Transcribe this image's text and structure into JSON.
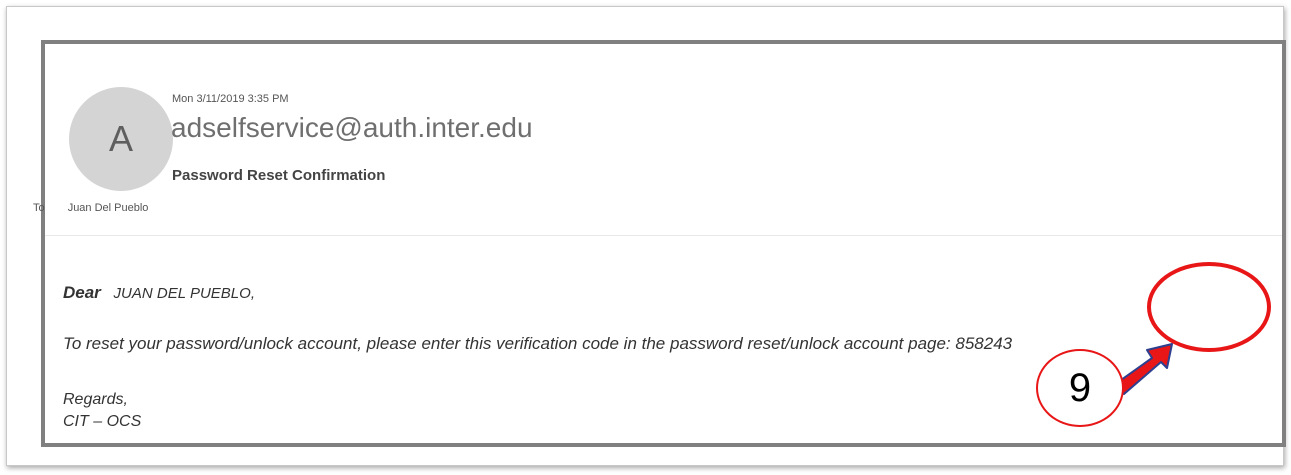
{
  "email": {
    "timestamp": "Mon 3/11/2019 3:35 PM",
    "avatar_initial": "A",
    "sender": "adselfservice@auth.inter.edu",
    "subject": "Password Reset Confirmation",
    "to_label": "To",
    "to_name": "Juan Del Pueblo"
  },
  "body": {
    "greeting_word": "Dear",
    "recipient": "JUAN DEL PUEBLO,",
    "message": "To reset your password/unlock account, please enter this verification code in the password reset/unlock account page: 858243",
    "regards": "Regards,",
    "signature": "CIT – OCS"
  },
  "annotation": {
    "step_number": "9",
    "color": "#e81616"
  },
  "colors": {
    "frame": "#808080",
    "avatar_bg": "#d4d4d4",
    "sender_text": "#6f6f6f"
  },
  "icons": [
    "arrow-annotation-icon"
  ]
}
